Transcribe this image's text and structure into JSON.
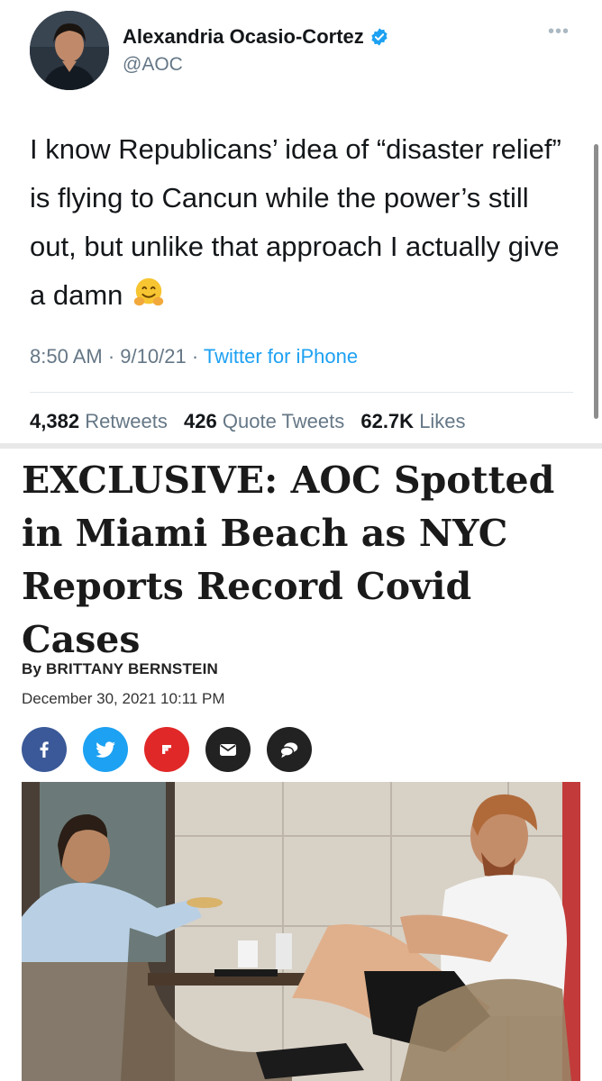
{
  "tweet": {
    "author_name": "Alexandria Ocasio-Cortez",
    "handle": "@AOC",
    "verified_icon": "verified-badge-icon",
    "text": "I know Republicans’ idea of “disaster relief” is flying to Cancun while the power’s still out, but unlike that approach I actually give a damn",
    "emoji": "hugging-face-emoji",
    "time": "8:50 AM",
    "date": "9/10/21",
    "source": "Twitter for iPhone",
    "stats": {
      "retweets_count": "4,382",
      "retweets_label": "Retweets",
      "quotes_count": "426",
      "quotes_label": "Quote Tweets",
      "likes_count": "62.7K",
      "likes_label": "Likes"
    }
  },
  "article": {
    "headline": "EXCLUSIVE: AOC Spotted in Miami Beach as NYC Reports Record Covid Cases",
    "byline": "By BRITTANY BERNSTEIN",
    "date": "December 30, 2021 10:11 PM",
    "share_buttons": [
      {
        "icon": "facebook-icon",
        "color": "#3b5998"
      },
      {
        "icon": "twitter-icon",
        "color": "#1da1f2"
      },
      {
        "icon": "flipboard-icon",
        "color": "#e12828"
      },
      {
        "icon": "email-icon",
        "color": "#222222"
      },
      {
        "icon": "comment-icon",
        "color": "#222222"
      }
    ]
  },
  "colors": {
    "link_blue": "#1da1f2",
    "muted_gray": "#657786",
    "text_dark": "#14171a"
  }
}
